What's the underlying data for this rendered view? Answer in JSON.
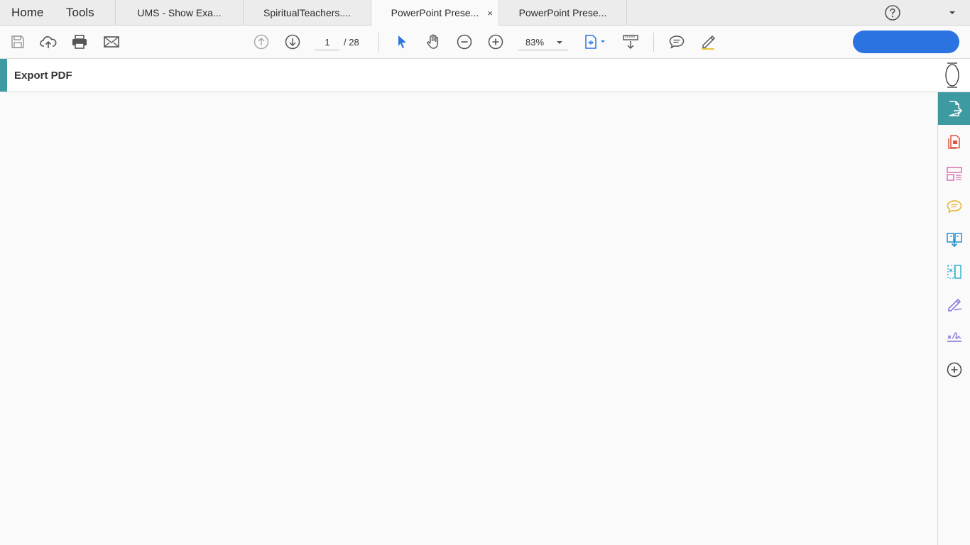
{
  "nav": {
    "home": "Home",
    "tools": "Tools"
  },
  "tabs": [
    {
      "label": "UMS - Show Exa...",
      "active": false
    },
    {
      "label": "SpiritualTeachers....",
      "active": false
    },
    {
      "label": "PowerPoint Prese...",
      "active": true,
      "close": "×"
    },
    {
      "label": "PowerPoint Prese...",
      "active": false
    }
  ],
  "toolbar": {
    "page_current": "1",
    "page_total": "/ 28",
    "zoom": "83%",
    "icons": [
      "save-icon",
      "upload-cloud-icon",
      "print-icon",
      "email-icon",
      "previous-page-icon",
      "next-page-icon",
      "select-cursor-icon",
      "hand-tool-icon",
      "zoom-out-icon",
      "zoom-in-icon",
      "fit-page-icon",
      "scroll-mode-icon",
      "comment-icon",
      "highlight-pen-icon"
    ],
    "action_button_label": ""
  },
  "panel": {
    "title": "Export PDF"
  },
  "right_rail": {
    "items": [
      "export-pdf-icon",
      "create-pdf-icon",
      "organize-pages-icon",
      "comment-tool-icon",
      "compress-pdf-icon",
      "edit-pdf-icon",
      "fill-sign-icon",
      "sign-icon",
      "more-tools-icon"
    ],
    "active": "export-pdf-icon"
  },
  "colors": {
    "accent_teal": "#3d9aa1",
    "blue_button": "#2a73e0",
    "rail_red": "#e0533f",
    "rail_pink": "#d86fb3",
    "rail_yellow": "#e8b32a",
    "rail_blue": "#2a8fd0",
    "rail_cyan": "#36b2cf",
    "rail_purple": "#7b6fd8"
  }
}
